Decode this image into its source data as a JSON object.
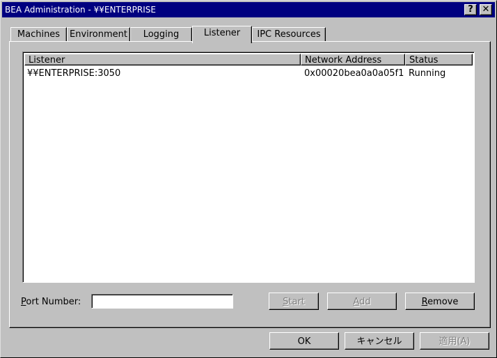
{
  "window": {
    "title": "BEA Administration - ¥¥ENTERPRISE",
    "help_glyph": "?",
    "close_glyph": "✕"
  },
  "tabs": [
    {
      "label": "Machines"
    },
    {
      "label": "Environment"
    },
    {
      "label": "Logging"
    },
    {
      "label": "Listener",
      "active": true
    },
    {
      "label": "IPC Resources"
    }
  ],
  "listview": {
    "columns": [
      "Listener",
      "Network Address",
      "Status"
    ],
    "rows": [
      [
        "¥¥ENTERPRISE:3050",
        "0x00020bea0a0a05f1",
        "Running"
      ]
    ]
  },
  "port": {
    "label": "Port Number:",
    "value": ""
  },
  "actions": {
    "start_label": "Start",
    "start_enabled": false,
    "add_label": "Add",
    "add_enabled": false,
    "remove_label": "Remove",
    "remove_enabled": true
  },
  "dialog": {
    "ok_label": "OK",
    "cancel_label": "キャンセル",
    "apply_label": "適用(A)",
    "apply_enabled": false
  },
  "colors": {
    "titlebar": "#000080",
    "face": "#c0c0c0",
    "disabled_text": "#808080"
  }
}
